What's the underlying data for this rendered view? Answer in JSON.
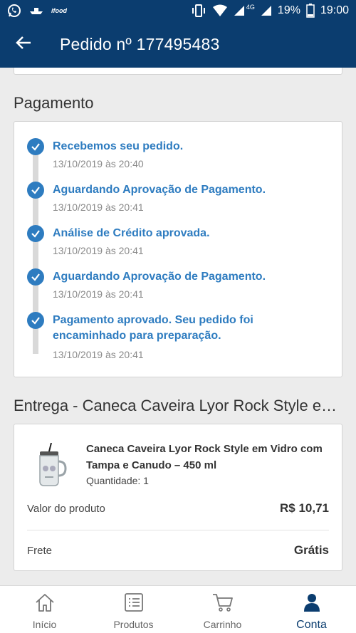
{
  "status_bar": {
    "app_label": "ifood",
    "network": "4G",
    "battery": "19%",
    "time": "19:00"
  },
  "header": {
    "title": "Pedido nº 177495483"
  },
  "payment": {
    "section_title": "Pagamento",
    "steps": [
      {
        "text": "Recebemos seu pedido.",
        "date": "13/10/2019 às 20:40"
      },
      {
        "text": "Aguardando Aprovação de Pagamento.",
        "date": "13/10/2019 às 20:41"
      },
      {
        "text": "Análise de Crédito aprovada.",
        "date": "13/10/2019 às 20:41"
      },
      {
        "text": "Aguardando Aprovação de Pagamento.",
        "date": "13/10/2019 às 20:41"
      },
      {
        "text": "Pagamento aprovado. Seu pedido foi encaminhado para preparação.",
        "date": "13/10/2019 às 20:41"
      }
    ]
  },
  "delivery": {
    "section_title": "Entrega - Caneca Caveira Lyor Rock Style e…",
    "product_name": "Caneca Caveira Lyor Rock Style em Vidro com Tampa e Canudo – 450 ml",
    "quantity": "Quantidade: 1",
    "value_label": "Valor do produto",
    "value": "R$ 10,71",
    "shipping_label": "Frete",
    "shipping_value": "Grátis"
  },
  "bottom_nav": {
    "items": [
      {
        "label": "Início"
      },
      {
        "label": "Produtos"
      },
      {
        "label": "Carrinho"
      },
      {
        "label": "Conta"
      }
    ],
    "active_color": "#0b3d6f"
  },
  "colors": {
    "primary": "#0b3d6f",
    "accent": "#2e7cc0"
  }
}
